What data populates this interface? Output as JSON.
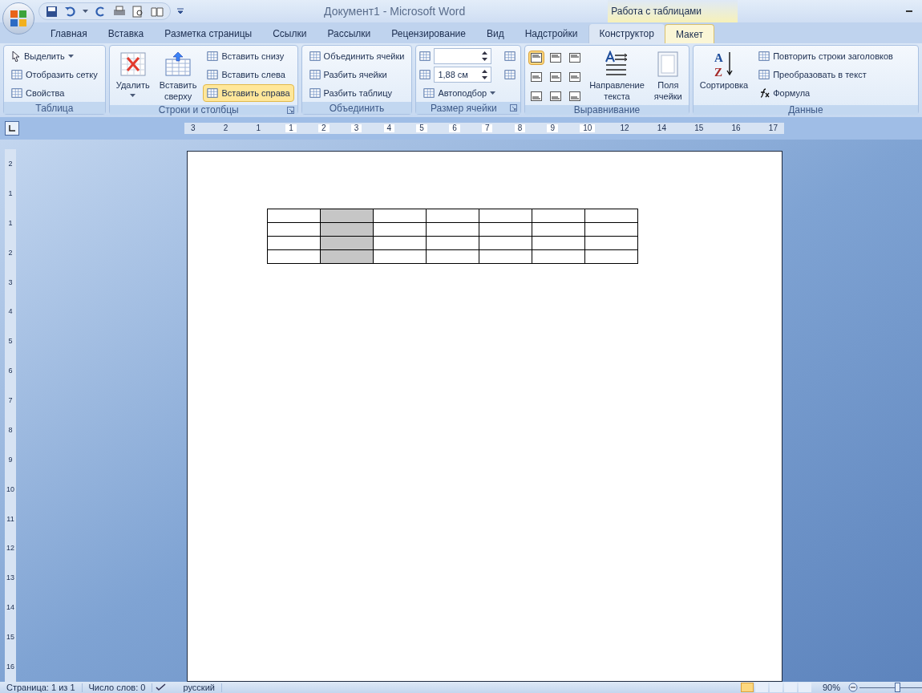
{
  "window": {
    "title": "Документ1 - Microsoft Word",
    "context_group": "Работа с таблицами"
  },
  "tabs": [
    {
      "label": "Главная",
      "selected": false,
      "contextual": false
    },
    {
      "label": "Вставка",
      "selected": false,
      "contextual": false
    },
    {
      "label": "Разметка страницы",
      "selected": false,
      "contextual": false
    },
    {
      "label": "Ссылки",
      "selected": false,
      "contextual": false
    },
    {
      "label": "Рассылки",
      "selected": false,
      "contextual": false
    },
    {
      "label": "Рецензирование",
      "selected": false,
      "contextual": false
    },
    {
      "label": "Вид",
      "selected": false,
      "contextual": false
    },
    {
      "label": "Надстройки",
      "selected": false,
      "contextual": false
    },
    {
      "label": "Конструктор",
      "selected": false,
      "contextual": true
    },
    {
      "label": "Макет",
      "selected": true,
      "contextual": true
    }
  ],
  "ribbon_groups": [
    {
      "name": "Таблица",
      "launcher": false,
      "columns": [
        [
          {
            "kind": "small",
            "label": "Выделить",
            "dropdown": true,
            "hovered": false
          },
          {
            "kind": "small",
            "label": "Отобразить сетку",
            "dropdown": false,
            "hovered": false
          },
          {
            "kind": "small",
            "label": "Свойства",
            "dropdown": false,
            "hovered": false
          }
        ]
      ]
    },
    {
      "name": "Строки и столбцы",
      "launcher": true,
      "columns": [
        [
          {
            "kind": "large",
            "lines": [
              "Удалить"
            ],
            "dropdown": true
          }
        ],
        [
          {
            "kind": "large",
            "lines": [
              "Вставить",
              "сверху"
            ],
            "dropdown": false
          }
        ],
        [
          {
            "kind": "small",
            "label": "Вставить снизу",
            "dropdown": false,
            "hovered": false
          },
          {
            "kind": "small",
            "label": "Вставить слева",
            "dropdown": false,
            "hovered": false
          },
          {
            "kind": "small",
            "label": "Вставить справа",
            "dropdown": false,
            "hovered": true
          }
        ]
      ]
    },
    {
      "name": "Объединить",
      "launcher": false,
      "columns": [
        [
          {
            "kind": "small",
            "label": "Объединить ячейки",
            "dropdown": false,
            "hovered": false
          },
          {
            "kind": "small",
            "label": "Разбить ячейки",
            "dropdown": false,
            "hovered": false
          },
          {
            "kind": "small",
            "label": "Разбить таблицу",
            "dropdown": false,
            "hovered": false
          }
        ]
      ]
    },
    {
      "name": "Размер ячейки",
      "launcher": true,
      "columns": [
        [
          {
            "kind": "spinner"
          },
          {
            "kind": "spinner",
            "value": "1,88 см"
          },
          {
            "kind": "small",
            "label": "Автоподбор",
            "dropdown": true,
            "hovered": false
          }
        ],
        [
          {
            "kind": "icon"
          },
          {
            "kind": "icon"
          }
        ]
      ]
    },
    {
      "name": "Выравнивание",
      "launcher": false,
      "columns": [
        [
          {
            "kind": "align",
            "cells": [
              {
                "selected": true
              },
              {
                "selected": false
              },
              {
                "selected": false
              },
              {
                "selected": false
              },
              {
                "selected": false
              },
              {
                "selected": false
              },
              {
                "selected": false
              },
              {
                "selected": false
              },
              {
                "selected": false
              }
            ]
          }
        ],
        [
          {
            "kind": "large",
            "lines": [
              "Направление",
              "текста"
            ],
            "dropdown": false
          }
        ],
        [
          {
            "kind": "large",
            "lines": [
              "Поля",
              "ячейки"
            ],
            "dropdown": false
          }
        ]
      ]
    },
    {
      "name": "Данные",
      "launcher": false,
      "columns": [
        [
          {
            "kind": "large",
            "lines": [
              "Сортировка"
            ],
            "dropdown": false,
            "icon_text": [
              "A",
              "Z"
            ]
          }
        ],
        [
          {
            "kind": "small",
            "label": "Повторить строки заголовков",
            "dropdown": false,
            "hovered": false
          },
          {
            "kind": "small",
            "label": "Преобразовать в текст",
            "dropdown": false,
            "hovered": false
          },
          {
            "kind": "small",
            "label": "Формула",
            "dropdown": false,
            "hovered": false
          }
        ]
      ]
    }
  ],
  "ruler": {
    "labels": [
      "3",
      "2",
      "1",
      "1",
      "2",
      "3",
      "4",
      "5",
      "6",
      "7",
      "8",
      "9",
      "10",
      "12",
      "14",
      "15",
      "16",
      "17"
    ]
  },
  "vertical_ruler": {
    "labels": [
      "2",
      "1",
      "1",
      "2",
      "3",
      "4",
      "5",
      "6",
      "7",
      "8",
      "9",
      "10",
      "11",
      "12",
      "13",
      "14",
      "15",
      "16"
    ]
  },
  "table": {
    "columns": [
      {
        "selected": false
      },
      {
        "selected": true
      },
      {
        "selected": false
      },
      {
        "selected": false
      },
      {
        "selected": false
      },
      {
        "selected": false
      },
      {
        "selected": false
      }
    ]
  },
  "status_bar": {
    "items": [
      "Страница: 1 из 1",
      "Число слов: 0",
      "русский"
    ],
    "views": [
      {
        "selected": true
      },
      {
        "selected": false
      },
      {
        "selected": false
      },
      {
        "selected": false
      },
      {
        "selected": false
      }
    ],
    "zoom": "90%",
    "zoom_level": {
      "level": 0.62
    }
  }
}
